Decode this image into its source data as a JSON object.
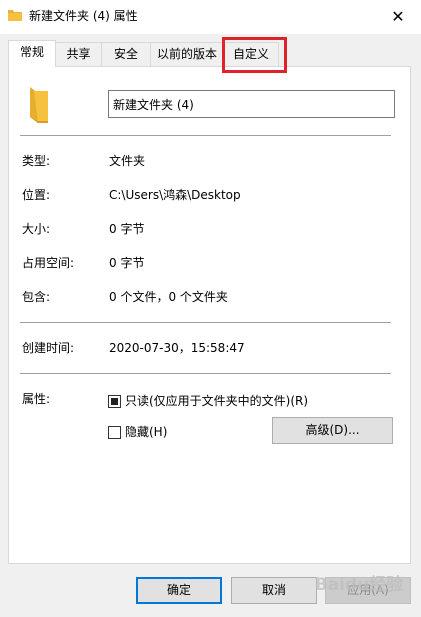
{
  "window": {
    "title": "新建文件夹 (4) 属性",
    "close_glyph": "✕"
  },
  "tabs": [
    {
      "label": "常规",
      "active": true
    },
    {
      "label": "共享",
      "active": false
    },
    {
      "label": "安全",
      "active": false
    },
    {
      "label": "以前的版本",
      "active": false
    },
    {
      "label": "自定义",
      "active": false
    }
  ],
  "general": {
    "folder_name": "新建文件夹 (4)",
    "fields": [
      {
        "label": "类型:",
        "value": "文件夹"
      },
      {
        "label": "位置:",
        "value": "C:\\Users\\鸿森\\Desktop"
      },
      {
        "label": "大小:",
        "value": "0 字节"
      },
      {
        "label": "占用空间:",
        "value": "0 字节"
      },
      {
        "label": "包含:",
        "value": "0 个文件，0 个文件夹"
      }
    ],
    "created": {
      "label": "创建时间:",
      "value": "2020-07-30，15:58:47"
    },
    "attributes": {
      "label": "属性:",
      "readonly_label": "只读(仅应用于文件夹中的文件)(R)",
      "readonly_state": "indeterminate",
      "hidden_label": "隐藏(H)",
      "hidden_checked": false,
      "advanced_label": "高级(D)..."
    }
  },
  "footer": {
    "ok_label": "确定",
    "cancel_label": "取消",
    "apply_label": "应用(A)"
  },
  "watermark": {
    "text": "Baidu经验"
  },
  "colors": {
    "highlight": "#e0232b",
    "folder": "#f6c13e",
    "default_button_border": "#0078d7"
  }
}
